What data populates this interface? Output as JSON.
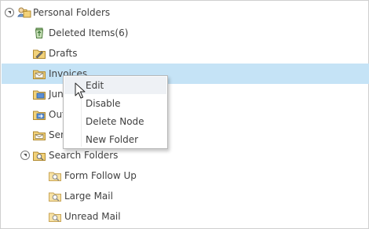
{
  "tree": {
    "root": {
      "label": "Personal Folders",
      "expanded": true
    },
    "items": [
      {
        "label": "Deleted Items(6)",
        "icon": "recycle-bin-icon"
      },
      {
        "label": "Drafts",
        "icon": "drafts-folder-icon"
      },
      {
        "label": "Invoices",
        "icon": "mail-folder-icon",
        "selected": true
      },
      {
        "label": "Junk E-mail",
        "icon": "junk-folder-icon"
      },
      {
        "label": "Outbox",
        "icon": "outbox-folder-icon"
      },
      {
        "label": "Sent Items",
        "icon": "sent-folder-icon"
      }
    ],
    "search": {
      "label": "Search Folders",
      "expanded": true,
      "items": [
        {
          "label": "Form Follow Up",
          "icon": "search-folder-icon"
        },
        {
          "label": "Large Mail",
          "icon": "search-folder-icon"
        },
        {
          "label": "Unread Mail",
          "icon": "search-folder-icon"
        }
      ]
    }
  },
  "context_menu": {
    "items": [
      {
        "label": "Edit",
        "hovered": true
      },
      {
        "label": "Disable"
      },
      {
        "label": "Delete Node"
      },
      {
        "label": "New Folder"
      }
    ]
  },
  "colors": {
    "selection": "#c5e3f6",
    "menu_hover": "#eef1f5",
    "folder": "#f2d27a"
  }
}
